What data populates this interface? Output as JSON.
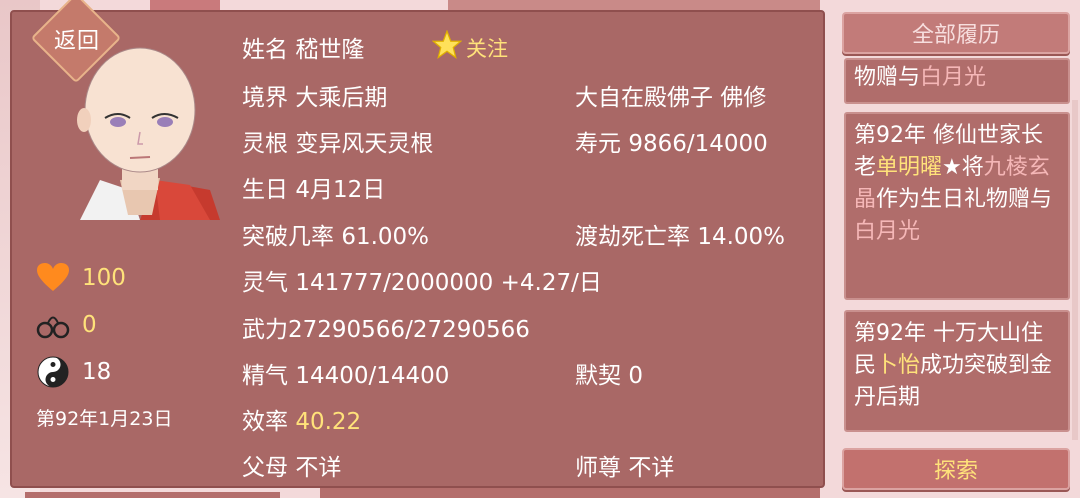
{
  "back_label": "返回",
  "profile": {
    "name_label": "姓名",
    "name": "嵇世隆",
    "follow_label": "关注",
    "realm_label": "境界",
    "realm": "大乘后期",
    "title": "大自在殿佛子",
    "title2": "佛修",
    "root_label": "灵根",
    "root": "变异风天灵根",
    "lifespan_label": "寿元",
    "lifespan": "9866/14000",
    "birthday_label": "生日",
    "birthday": "4月12日",
    "breakthrough_label": "突破几率",
    "breakthrough": "61.00%",
    "tribulation_label": "渡劫死亡率",
    "tribulation": "14.00%",
    "qi_label": "灵气",
    "qi": "141777/2000000 +4.27/日",
    "force_label": "武力",
    "force": "27290566/27290566",
    "essence_label": "精气",
    "essence": "14400/14400",
    "tacit_label": "默契",
    "tacit": "0",
    "efficiency_label": "效率",
    "efficiency": "40.22",
    "parents_label": "父母",
    "parents": "不详",
    "master_label": "师尊",
    "master": "不详"
  },
  "left_stats": {
    "hearts": "100",
    "chains": "0",
    "yinyang": "18",
    "date": "第92年1月23日"
  },
  "right": {
    "history_button": "全部履历",
    "event0_a": "物赠与",
    "event0_b": "白月光",
    "event1_a": "第92年 修仙世家长老",
    "event1_name": "单明曜",
    "event1_star": "★",
    "event1_b": "将",
    "event1_item": "九棱玄晶",
    "event1_c": "作为生日礼物赠与",
    "event1_target": "白月光",
    "event2_a": "第92年 十万大山住民",
    "event2_name": "卜怡",
    "event2_b": "成功突破到金丹后期",
    "explore_button": "探索"
  },
  "colors": {
    "panel": "#a96866",
    "highlight_yellow": "#ffe27a",
    "highlight_pink": "#f5b7b7",
    "heart": "#ff8a1e"
  }
}
